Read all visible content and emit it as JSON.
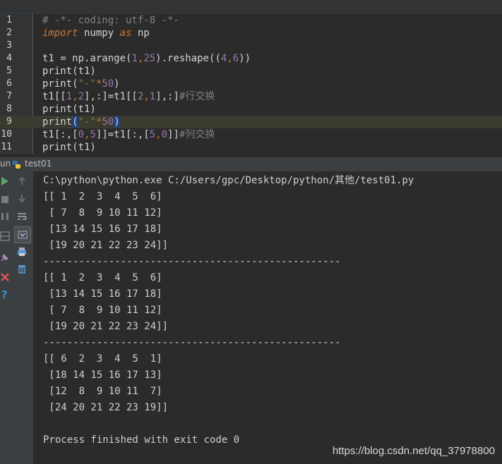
{
  "editor": {
    "line_numbers": [
      "1",
      "2",
      "3",
      "4",
      "5",
      "6",
      "7",
      "8",
      "9",
      "10",
      "11"
    ],
    "line1": {
      "comment": "# -*- coding: utf-8 -*-"
    },
    "line2": {
      "kw_import": "import",
      "mod": " numpy ",
      "kw_as": "as",
      "alias": " np"
    },
    "line4": {
      "pre": "t1 = np.arange(",
      "n1": "1",
      "comma": ",",
      "n2": "25",
      "mid": ").reshape((",
      "n3": "4",
      "comma2": ",",
      "n4": "6",
      "post": "))"
    },
    "line5": {
      "text": "print(t1)"
    },
    "line6": {
      "pre": "print(",
      "str": "\"-\"",
      "op": "*",
      "num": "50",
      "post": ")"
    },
    "line7": {
      "a": "t1[[",
      "n1": "1",
      "b": ",",
      "n2": "2",
      "c": "],:]=t1[[",
      "n3": "2",
      "d": ",",
      "n4": "1",
      "e": "],:]",
      "comment": "#行交换"
    },
    "line8": {
      "text": "print(t1)"
    },
    "line9": {
      "pre": "print",
      "open": "(",
      "str": "\"-\"",
      "op": "*",
      "num": "50",
      "close": ")"
    },
    "line10": {
      "a": "t1[:,[",
      "n1": "0",
      "b": ",",
      "n2": "5",
      "c": "]]=t1[:,[",
      "n3": "5",
      "d": ",",
      "n4": "0",
      "e": "]]",
      "comment": "#列交换"
    },
    "line11": {
      "text": "print(t1)"
    }
  },
  "run_panel": {
    "label": "un",
    "tab_name": "test01"
  },
  "console": {
    "lines": [
      "C:\\python\\python.exe C:/Users/gpc/Desktop/python/其他/test01.py",
      "[[ 1  2  3  4  5  6]",
      " [ 7  8  9 10 11 12]",
      " [13 14 15 16 17 18]",
      " [19 20 21 22 23 24]]",
      "--------------------------------------------------",
      "[[ 1  2  3  4  5  6]",
      " [13 14 15 16 17 18]",
      " [ 7  8  9 10 11 12]",
      " [19 20 21 22 23 24]]",
      "--------------------------------------------------",
      "[[ 6  2  3  4  5  1]",
      " [18 14 15 16 17 13]",
      " [12  8  9 10 11  7]",
      " [24 20 21 22 23 19]]",
      "",
      "Process finished with exit code 0"
    ]
  },
  "watermark": "https://blog.csdn.net/qq_37978800",
  "toolbar_icons": {
    "left": [
      "run-icon",
      "stop-icon",
      "pause-icon",
      "layout-icon",
      "pin-icon",
      "close-icon",
      "help-icon"
    ],
    "mid": [
      "arrow-up-icon",
      "arrow-down-icon",
      "wrap-icon",
      "scroll-end-icon",
      "print-icon",
      "trash-icon"
    ]
  },
  "colors": {
    "keyword": "#cc7832",
    "number": "#9876aa",
    "string": "#6a8759",
    "comment": "#808080",
    "run_green": "#59a869",
    "close_red": "#e05555",
    "help_blue": "#3592c4"
  }
}
